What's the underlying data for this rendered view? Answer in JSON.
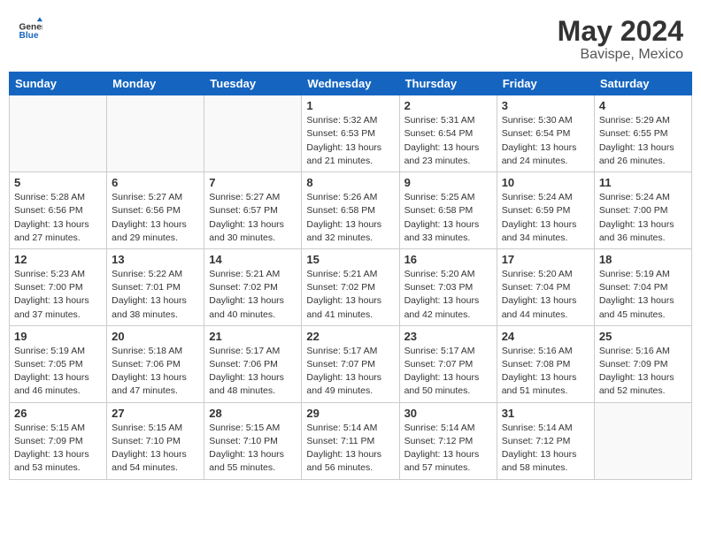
{
  "header": {
    "logo_general": "General",
    "logo_blue": "Blue",
    "month_year": "May 2024",
    "location": "Bavispe, Mexico"
  },
  "weekdays": [
    "Sunday",
    "Monday",
    "Tuesday",
    "Wednesday",
    "Thursday",
    "Friday",
    "Saturday"
  ],
  "weeks": [
    [
      {
        "day": "",
        "info": ""
      },
      {
        "day": "",
        "info": ""
      },
      {
        "day": "",
        "info": ""
      },
      {
        "day": "1",
        "info": "Sunrise: 5:32 AM\nSunset: 6:53 PM\nDaylight: 13 hours\nand 21 minutes."
      },
      {
        "day": "2",
        "info": "Sunrise: 5:31 AM\nSunset: 6:54 PM\nDaylight: 13 hours\nand 23 minutes."
      },
      {
        "day": "3",
        "info": "Sunrise: 5:30 AM\nSunset: 6:54 PM\nDaylight: 13 hours\nand 24 minutes."
      },
      {
        "day": "4",
        "info": "Sunrise: 5:29 AM\nSunset: 6:55 PM\nDaylight: 13 hours\nand 26 minutes."
      }
    ],
    [
      {
        "day": "5",
        "info": "Sunrise: 5:28 AM\nSunset: 6:56 PM\nDaylight: 13 hours\nand 27 minutes."
      },
      {
        "day": "6",
        "info": "Sunrise: 5:27 AM\nSunset: 6:56 PM\nDaylight: 13 hours\nand 29 minutes."
      },
      {
        "day": "7",
        "info": "Sunrise: 5:27 AM\nSunset: 6:57 PM\nDaylight: 13 hours\nand 30 minutes."
      },
      {
        "day": "8",
        "info": "Sunrise: 5:26 AM\nSunset: 6:58 PM\nDaylight: 13 hours\nand 32 minutes."
      },
      {
        "day": "9",
        "info": "Sunrise: 5:25 AM\nSunset: 6:58 PM\nDaylight: 13 hours\nand 33 minutes."
      },
      {
        "day": "10",
        "info": "Sunrise: 5:24 AM\nSunset: 6:59 PM\nDaylight: 13 hours\nand 34 minutes."
      },
      {
        "day": "11",
        "info": "Sunrise: 5:24 AM\nSunset: 7:00 PM\nDaylight: 13 hours\nand 36 minutes."
      }
    ],
    [
      {
        "day": "12",
        "info": "Sunrise: 5:23 AM\nSunset: 7:00 PM\nDaylight: 13 hours\nand 37 minutes."
      },
      {
        "day": "13",
        "info": "Sunrise: 5:22 AM\nSunset: 7:01 PM\nDaylight: 13 hours\nand 38 minutes."
      },
      {
        "day": "14",
        "info": "Sunrise: 5:21 AM\nSunset: 7:02 PM\nDaylight: 13 hours\nand 40 minutes."
      },
      {
        "day": "15",
        "info": "Sunrise: 5:21 AM\nSunset: 7:02 PM\nDaylight: 13 hours\nand 41 minutes."
      },
      {
        "day": "16",
        "info": "Sunrise: 5:20 AM\nSunset: 7:03 PM\nDaylight: 13 hours\nand 42 minutes."
      },
      {
        "day": "17",
        "info": "Sunrise: 5:20 AM\nSunset: 7:04 PM\nDaylight: 13 hours\nand 44 minutes."
      },
      {
        "day": "18",
        "info": "Sunrise: 5:19 AM\nSunset: 7:04 PM\nDaylight: 13 hours\nand 45 minutes."
      }
    ],
    [
      {
        "day": "19",
        "info": "Sunrise: 5:19 AM\nSunset: 7:05 PM\nDaylight: 13 hours\nand 46 minutes."
      },
      {
        "day": "20",
        "info": "Sunrise: 5:18 AM\nSunset: 7:06 PM\nDaylight: 13 hours\nand 47 minutes."
      },
      {
        "day": "21",
        "info": "Sunrise: 5:17 AM\nSunset: 7:06 PM\nDaylight: 13 hours\nand 48 minutes."
      },
      {
        "day": "22",
        "info": "Sunrise: 5:17 AM\nSunset: 7:07 PM\nDaylight: 13 hours\nand 49 minutes."
      },
      {
        "day": "23",
        "info": "Sunrise: 5:17 AM\nSunset: 7:07 PM\nDaylight: 13 hours\nand 50 minutes."
      },
      {
        "day": "24",
        "info": "Sunrise: 5:16 AM\nSunset: 7:08 PM\nDaylight: 13 hours\nand 51 minutes."
      },
      {
        "day": "25",
        "info": "Sunrise: 5:16 AM\nSunset: 7:09 PM\nDaylight: 13 hours\nand 52 minutes."
      }
    ],
    [
      {
        "day": "26",
        "info": "Sunrise: 5:15 AM\nSunset: 7:09 PM\nDaylight: 13 hours\nand 53 minutes."
      },
      {
        "day": "27",
        "info": "Sunrise: 5:15 AM\nSunset: 7:10 PM\nDaylight: 13 hours\nand 54 minutes."
      },
      {
        "day": "28",
        "info": "Sunrise: 5:15 AM\nSunset: 7:10 PM\nDaylight: 13 hours\nand 55 minutes."
      },
      {
        "day": "29",
        "info": "Sunrise: 5:14 AM\nSunset: 7:11 PM\nDaylight: 13 hours\nand 56 minutes."
      },
      {
        "day": "30",
        "info": "Sunrise: 5:14 AM\nSunset: 7:12 PM\nDaylight: 13 hours\nand 57 minutes."
      },
      {
        "day": "31",
        "info": "Sunrise: 5:14 AM\nSunset: 7:12 PM\nDaylight: 13 hours\nand 58 minutes."
      },
      {
        "day": "",
        "info": ""
      }
    ]
  ]
}
